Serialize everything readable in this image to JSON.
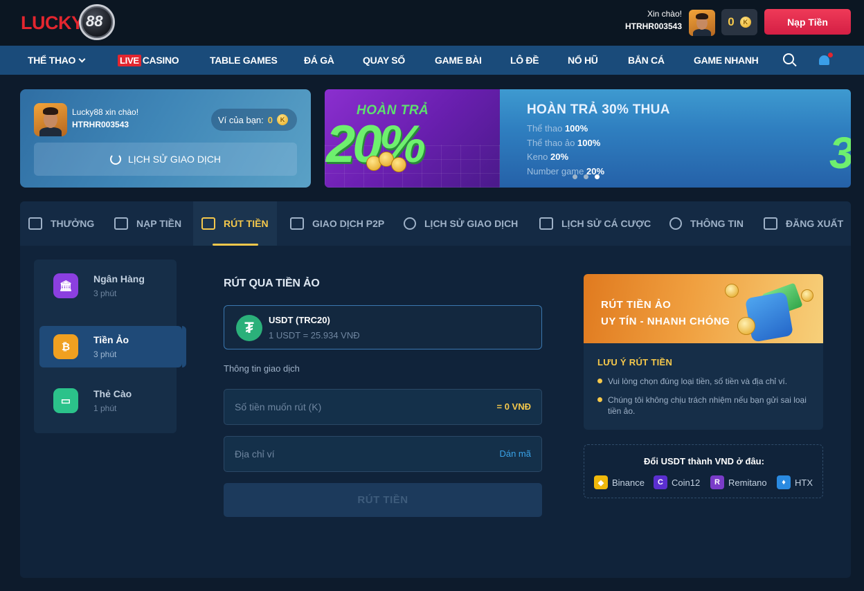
{
  "header": {
    "logo_text": "LUCKY",
    "logo_number": "88",
    "greeting": "Xin chào!",
    "username": "HTRHR003543",
    "balance": "0",
    "coin_symbol": "K",
    "deposit_button": "Nạp Tiền"
  },
  "nav": {
    "items": [
      "THỂ THAO",
      "CASINO",
      "TABLE GAMES",
      "ĐÁ GÀ",
      "QUAY SỐ",
      "GAME BÀI",
      "LÔ ĐỀ",
      "NỔ HŨ",
      "BẮN CÁ",
      "GAME NHANH"
    ],
    "live_badge": "LIVE"
  },
  "profile": {
    "greeting": "Lucky88 xin chào!",
    "username": "HTRHR003543",
    "wallet_label": "Ví của bạn:",
    "wallet_value": "0",
    "history_button": "LỊCH SỬ GIAO DỊCH"
  },
  "banners": {
    "promo1_title": "HOÀN TRẢ",
    "promo1_value": "20%",
    "promo2_title": "HOÀN TRẢ 30% THUA",
    "promo2_rows": [
      {
        "label": "Thể thao",
        "value": "100%"
      },
      {
        "label": "Thể thao ảo",
        "value": "100%"
      },
      {
        "label": "Keno",
        "value": "20%"
      },
      {
        "label": "Number game",
        "value": "20%"
      }
    ],
    "promo2_peek": "3",
    "active_slide": 3
  },
  "tabs": [
    "THƯỞNG",
    "NẠP TIỀN",
    "RÚT TIỀN",
    "GIAO DỊCH P2P",
    "LỊCH SỬ GIAO DỊCH",
    "LỊCH SỬ CÁ CƯỢC",
    "THÔNG TIN",
    "ĐĂNG XUẤT"
  ],
  "active_tab": "RÚT TIỀN",
  "methods": [
    {
      "name": "Ngân Hàng",
      "time": "3 phút",
      "color": "#8b3fe0"
    },
    {
      "name": "Tiền Ảo",
      "time": "3 phút",
      "color": "#f0a020"
    },
    {
      "name": "Thẻ Cào",
      "time": "1 phút",
      "color": "#2bc28a"
    }
  ],
  "form": {
    "title": "RÚT QUA TIỀN ẢO",
    "currency_name": "USDT (TRC20)",
    "currency_rate": "1 USDT = 25.934 VNĐ",
    "section_label": "Thông tin giao dịch",
    "amount_placeholder": "Số tiền muốn rút (K)",
    "amount_converted": "= 0 VNĐ",
    "wallet_placeholder": "Địa chỉ ví",
    "paste_label": "Dán mã",
    "submit_label": "RÚT TIỀN"
  },
  "info": {
    "promo_line1": "RÚT TIỀN ẢO",
    "promo_line2": "UY TÍN - NHANH CHÓNG",
    "notes_title": "LƯU Ý RÚT TIỀN",
    "notes": [
      "Vui lòng chọn đúng loại tiền, số tiền và địa chỉ ví.",
      "Chúng tôi không chịu trách nhiệm nếu bạn gửi sai loại tiền ảo."
    ],
    "exchange_title": "Đổi USDT thành VND ở đâu:",
    "exchanges": [
      {
        "name": "Binance",
        "color": "#f0b90b"
      },
      {
        "name": "Coin12",
        "color": "#5b2fd0"
      },
      {
        "name": "Remitano",
        "color": "#7a3cc8"
      },
      {
        "name": "HTX",
        "color": "#2a8ae0"
      }
    ]
  }
}
